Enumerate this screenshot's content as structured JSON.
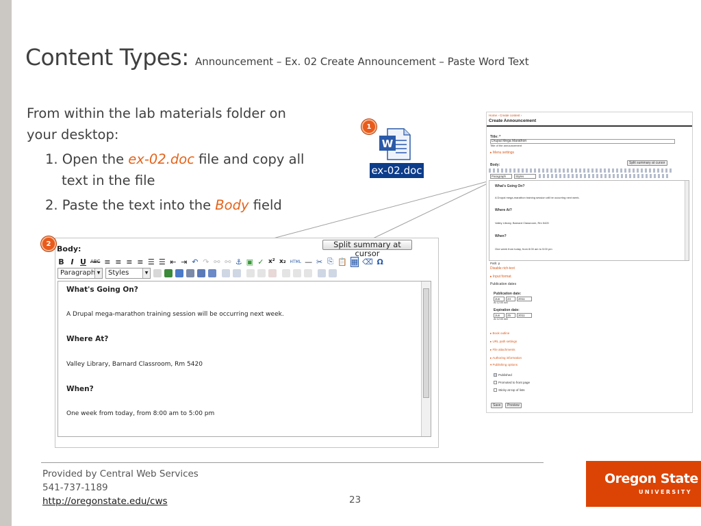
{
  "slide": {
    "title_main": "Content Types:",
    "title_sub": "Announcement – Ex. 02 Create Announcement – Paste Word Text",
    "intro": "From within the lab materials folder on your desktop:",
    "steps": [
      {
        "pre": "1. Open the ",
        "highlight": "ex-02.doc",
        "post": " file and copy all text in the file"
      },
      {
        "pre": "2. Paste the text into the ",
        "highlight": "Body",
        "post": " field"
      }
    ],
    "badges": [
      "1",
      "2"
    ],
    "doc_file_label": "ex-02.doc",
    "doc_icon": "word-document-icon"
  },
  "mini_screenshot": {
    "breadcrumb": "Home › Create content ›",
    "page_title": "Create Announcement",
    "title_label": "Title: *",
    "title_value": "Drupal Mega Marathon",
    "title_help": "Title of the announcement",
    "menu_settings": "▸ Menu settings",
    "split_button": "Split summary at cursor",
    "body_label": "Body:",
    "format_select": "Paragraph",
    "styles_select": "Styles",
    "editor_lines": [
      {
        "text": "What's Going On?",
        "bold": true
      },
      {
        "text": "A Drupal mega-marathon training session will be occurring next week.",
        "bold": false
      },
      {
        "text": "Where At?",
        "bold": true
      },
      {
        "text": "Valley Library, Barnard Classroom, Rm 5420",
        "bold": false
      },
      {
        "text": "When?",
        "bold": true
      },
      {
        "text": "One week from today, from 8:00 am to 5:00 pm",
        "bold": false
      }
    ],
    "path": "Path: p",
    "disable_rich_text": "Disable rich-text",
    "input_format": "▸ Input format",
    "publication_dates": "Publication dates",
    "publication_date_label": "Publication date:",
    "publication_month": "Jun",
    "publication_day": "24",
    "publication_year": "2011",
    "publication_time": "At 12:00 AM",
    "expiration_date_label": "Expiration date:",
    "expiration_month": "Jun",
    "expiration_day": "25",
    "expiration_year": "2011",
    "expiration_time": "At 12:00 AM",
    "collapsed_sections": [
      "▸ Book outline",
      "▸ URL path settings",
      "▸ File attachments",
      "▸ Authoring information",
      "▾ Publishing options"
    ],
    "checkboxes": [
      {
        "label": "Published",
        "checked": true
      },
      {
        "label": "Promoted to front page",
        "checked": false
      },
      {
        "label": "Sticky at top of lists",
        "checked": false
      }
    ],
    "save_button": "Save",
    "preview_button": "Preview"
  },
  "zoomed_editor": {
    "body_label": "Body:",
    "split_button": "Split summary at cursor",
    "toolbar_row1": [
      "B",
      "I",
      "U",
      "ABC",
      "≡",
      "≡",
      "≡",
      "≡",
      "☰",
      "☰",
      "⇤",
      "⇥",
      "↶",
      "↷",
      "⚯",
      "⚯",
      "⚓",
      "▣",
      "✓",
      "x²",
      "x₂",
      "HTML",
      "—",
      "✂",
      "⎘",
      "📋",
      "▦",
      "⌫",
      "Ω"
    ],
    "format_select": "Paragraph",
    "styles_select": "Styles",
    "editor_lines": [
      {
        "text": "What's Going On?",
        "bold": true
      },
      {
        "text": "A Drupal mega-marathon training session will be occurring next week.",
        "bold": false
      },
      {
        "text": "Where At?",
        "bold": true
      },
      {
        "text": "Valley Library, Barnard Classroom, Rm 5420",
        "bold": false
      },
      {
        "text": "When?",
        "bold": true
      },
      {
        "text": "One week from today, from 8:00 am to 5:00 pm",
        "bold": false
      }
    ]
  },
  "footer": {
    "line1": "Provided by Central Web Services",
    "line2": "541-737-1189",
    "link": "http://oregonstate.edu/cws",
    "page_number": "23"
  },
  "logo": {
    "line1": "Oregon State",
    "line2": "UNIVERSITY",
    "color": "#dc4405"
  },
  "colors": {
    "accent": "#e5631a",
    "badge": "#e85b1b"
  }
}
